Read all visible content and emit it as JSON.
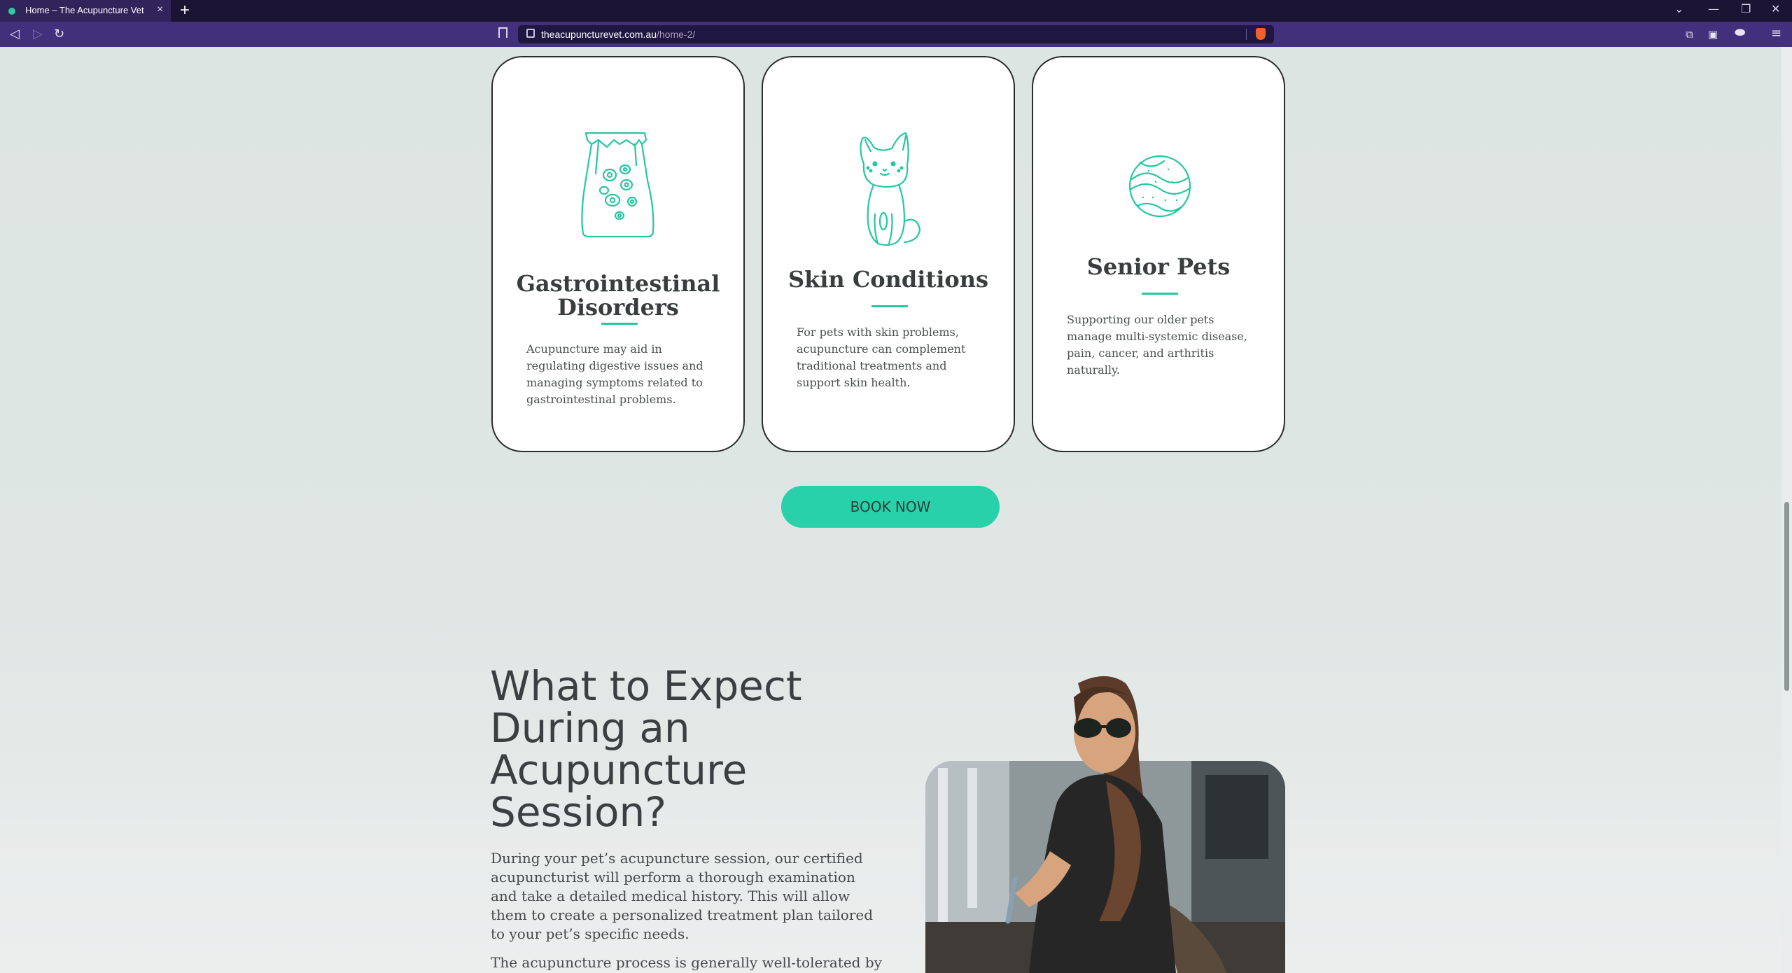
{
  "browser": {
    "tab_title": "Home – The Acupuncture Vet",
    "tab_close": "×",
    "new_tab": "+",
    "url_host": "theacupuncturevet.com.au",
    "url_path": "/home-2/",
    "icons": [
      "back-icon",
      "forward-icon",
      "reload-icon",
      "bookmark-icon",
      "lock-icon",
      "brave-shield-icon",
      "extensions-icon",
      "sidebar-icon",
      "wallet-icon",
      "menu-icon"
    ]
  },
  "cards": [
    {
      "title": "Gastrointestinal Disorders",
      "text": "Acupuncture may aid in regulating digestive issues and managing symptoms related to gastrointestinal problems.",
      "icon": "food-bag-icon"
    },
    {
      "title": "Skin Conditions",
      "text": "For pets with skin problems, acupuncture can complement traditional treatments and support skin health.",
      "icon": "dog-icon"
    },
    {
      "title": "Senior Pets",
      "text": "Supporting our older pets manage multi-systemic disease, pain, cancer, and arthritis naturally.",
      "icon": "ball-icon"
    }
  ],
  "cta": {
    "label": "BOOK NOW"
  },
  "expect": {
    "title": "What to Expect During an Acupuncture Session?",
    "paragraph1": "During your pet’s acupuncture session, our certified acupuncturist will perform a thorough examination and take a detailed medical history. This will allow them to create a personalized treatment plan tailored to your pet’s specific needs.",
    "paragraph2": "The acupuncture process is generally well-tolerated by"
  },
  "colors": {
    "accent": "#28d1aa",
    "icon_stroke": "#25c7a0",
    "tab_bar": "#1c1434",
    "nav_bar": "#43307c",
    "page_bg": "#dfe6e4"
  }
}
